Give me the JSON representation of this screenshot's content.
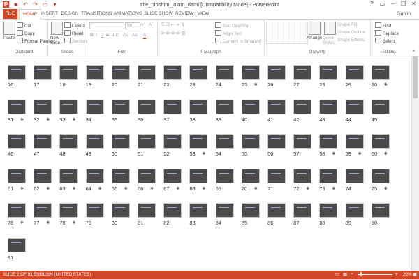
{
  "window": {
    "title": "trife_bioshimi_olom_dami [Compatibility Mode] - PowerPoint",
    "help_glyph": "?",
    "minimize_glyph": "–",
    "restore_glyph": "❐",
    "close_glyph": "✕"
  },
  "tabs": [
    "FILE",
    "HOME",
    "INSERT",
    "DESIGN",
    "TRANSITIONS",
    "ANIMATIONS",
    "SLIDE SHOW",
    "REVIEW",
    "VIEW"
  ],
  "sign_in": "Sign in",
  "ribbon": {
    "clipboard": {
      "paste": "Paste",
      "cut": "Cut",
      "copy": "Copy",
      "format_painter": "Format Painter",
      "label": "Clipboard"
    },
    "slides": {
      "new_slide": "New Slide",
      "layout": "Layout",
      "reset": "Reset",
      "section": "Section",
      "label": "Slides"
    },
    "font": {
      "size": "66",
      "label": "Font",
      "bold": "B",
      "italic": "I",
      "underline": "U",
      "strike": "S",
      "shadow": "abc",
      "spacing": "AV",
      "case": "Aa",
      "color": "A"
    },
    "paragraph": {
      "text_direction": "Text Direction",
      "align_text": "Align Text",
      "convert_smartart": "Convert to SmartArt",
      "label": "Paragraph"
    },
    "drawing": {
      "arrange": "Arrange",
      "quick_styles": "Quick Styles",
      "shape_fill": "Shape Fill",
      "shape_outline": "Shape Outline",
      "shape_effects": "Shape Effects",
      "label": "Drawing"
    },
    "editing": {
      "find": "Find",
      "replace": "Replace",
      "select": "Select",
      "label": "Editing"
    }
  },
  "slides": [
    {
      "n": "16",
      "star": false
    },
    {
      "n": "17",
      "star": false
    },
    {
      "n": "18",
      "star": false
    },
    {
      "n": "19",
      "star": false
    },
    {
      "n": "20",
      "star": false
    },
    {
      "n": "21",
      "star": false
    },
    {
      "n": "22",
      "star": false
    },
    {
      "n": "23",
      "star": false
    },
    {
      "n": "24",
      "star": false
    },
    {
      "n": "25",
      "star": true
    },
    {
      "n": "26",
      "star": false
    },
    {
      "n": "27",
      "star": false
    },
    {
      "n": "28",
      "star": false
    },
    {
      "n": "29",
      "star": false
    },
    {
      "n": "30",
      "star": true
    },
    {
      "n": "31",
      "star": true
    },
    {
      "n": "32",
      "star": true
    },
    {
      "n": "33",
      "star": true
    },
    {
      "n": "34",
      "star": false
    },
    {
      "n": "35",
      "star": false
    },
    {
      "n": "36",
      "star": false
    },
    {
      "n": "37",
      "star": false
    },
    {
      "n": "38",
      "star": false
    },
    {
      "n": "39",
      "star": false
    },
    {
      "n": "40",
      "star": false
    },
    {
      "n": "41",
      "star": false
    },
    {
      "n": "42",
      "star": false
    },
    {
      "n": "43",
      "star": false
    },
    {
      "n": "44",
      "star": false
    },
    {
      "n": "45",
      "star": false
    },
    {
      "n": "46",
      "star": false
    },
    {
      "n": "47",
      "star": false
    },
    {
      "n": "48",
      "star": false
    },
    {
      "n": "49",
      "star": false
    },
    {
      "n": "50",
      "star": false
    },
    {
      "n": "51",
      "star": false
    },
    {
      "n": "52",
      "star": false
    },
    {
      "n": "53",
      "star": true
    },
    {
      "n": "54",
      "star": false
    },
    {
      "n": "55",
      "star": false
    },
    {
      "n": "56",
      "star": false
    },
    {
      "n": "57",
      "star": false
    },
    {
      "n": "58",
      "star": true
    },
    {
      "n": "59",
      "star": true
    },
    {
      "n": "60",
      "star": true
    },
    {
      "n": "61",
      "star": true
    },
    {
      "n": "62",
      "star": true
    },
    {
      "n": "63",
      "star": true
    },
    {
      "n": "64",
      "star": true
    },
    {
      "n": "65",
      "star": true
    },
    {
      "n": "66",
      "star": true
    },
    {
      "n": "67",
      "star": true
    },
    {
      "n": "68",
      "star": true
    },
    {
      "n": "69",
      "star": false
    },
    {
      "n": "70",
      "star": true
    },
    {
      "n": "71",
      "star": false
    },
    {
      "n": "72",
      "star": true
    },
    {
      "n": "73",
      "star": true
    },
    {
      "n": "74",
      "star": false
    },
    {
      "n": "75",
      "star": true
    },
    {
      "n": "76",
      "star": true
    },
    {
      "n": "77",
      "star": true
    },
    {
      "n": "78",
      "star": true
    },
    {
      "n": "79",
      "star": false
    },
    {
      "n": "80",
      "star": false
    },
    {
      "n": "81",
      "star": false
    },
    {
      "n": "82",
      "star": false
    },
    {
      "n": "83",
      "star": false
    },
    {
      "n": "84",
      "star": false
    },
    {
      "n": "85",
      "star": false
    },
    {
      "n": "86",
      "star": false
    },
    {
      "n": "87",
      "star": false
    },
    {
      "n": "88",
      "star": false
    },
    {
      "n": "89",
      "star": false
    },
    {
      "n": "90",
      "star": false
    },
    {
      "n": "91",
      "star": false
    }
  ],
  "star_glyph": "✱",
  "status": {
    "slide_info": "SLIDE 2 OF 91",
    "language": "ENGLISH (UNITED STATES)",
    "zoom": "20%",
    "zoom_minus": "−",
    "zoom_plus": "+"
  },
  "colors": {
    "accent": "#d24726",
    "thumb_bg": "#4a4a4a"
  }
}
